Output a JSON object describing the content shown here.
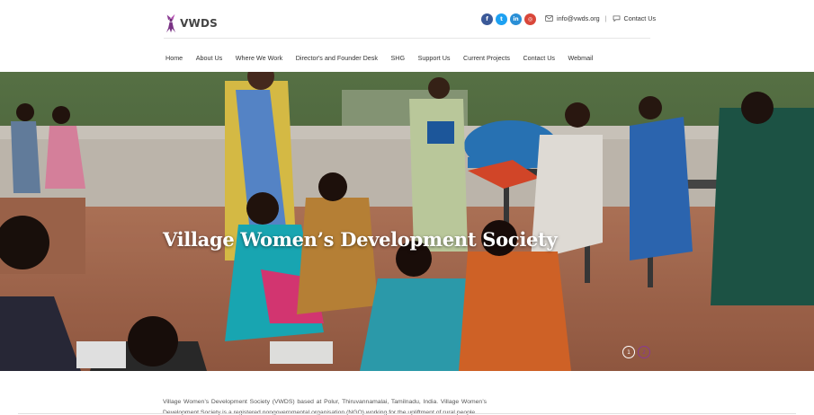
{
  "header": {
    "logo_text": "VWDS",
    "socials": [
      {
        "icon": "facebook-icon",
        "glyph": "f",
        "color": "#3b5998"
      },
      {
        "icon": "twitter-icon",
        "glyph": "t",
        "color": "#1da1f2"
      },
      {
        "icon": "linkedin-icon",
        "glyph": "in",
        "color": "#2a8fd6"
      },
      {
        "icon": "instagram-icon",
        "glyph": "◎",
        "color": "#d9473a"
      }
    ],
    "email": "info@vwds.org",
    "contact_label": "Contact Us",
    "separator": "|"
  },
  "nav": {
    "items": [
      "Home",
      "About Us",
      "Where We Work",
      "Director's and Founder Desk",
      "SHG",
      "Support Us",
      "Current Projects",
      "Contact Us",
      "Webmail"
    ]
  },
  "hero": {
    "title": "Village Women’s Development Society",
    "slides": [
      "1",
      "2"
    ],
    "active_slide": 1
  },
  "intro": {
    "text": "Village Women’s Development Society (VWDS) based at Polur, Thiruvannamalai, Tamilnadu, India. Village Women’s Development Society is a registered nongovernmental organisation (NGO) working for the upliftment of rural people"
  },
  "colors": {
    "brand_purple": "#8a3a92",
    "text": "#333333"
  }
}
